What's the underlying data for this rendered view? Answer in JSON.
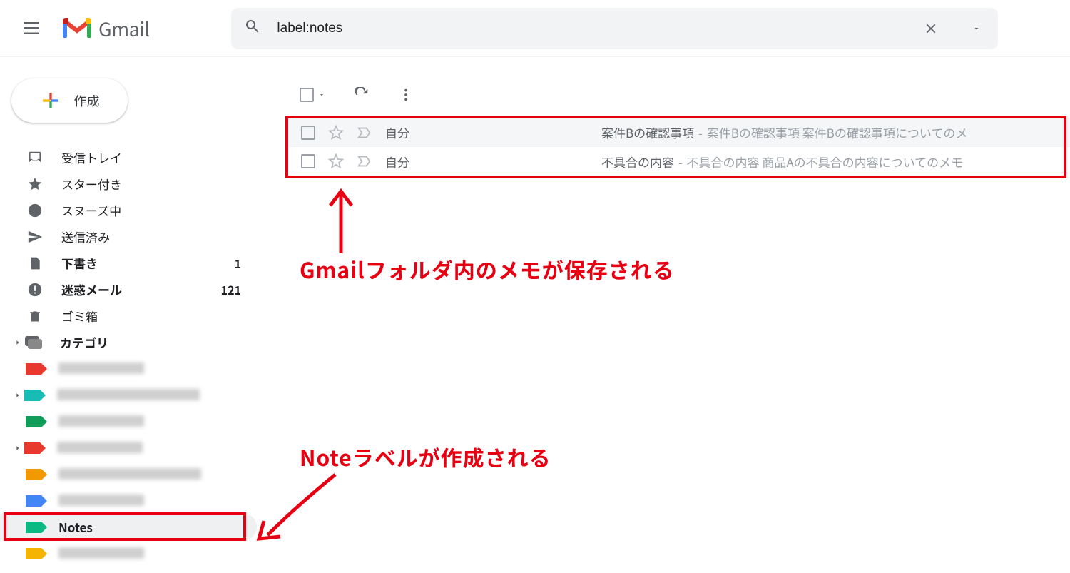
{
  "header": {
    "app_name": "Gmail",
    "search_value": "label:notes"
  },
  "sidebar": {
    "compose_label": "作成",
    "items": [
      {
        "label": "受信トレイ",
        "count": ""
      },
      {
        "label": "スター付き",
        "count": ""
      },
      {
        "label": "スヌーズ中",
        "count": ""
      },
      {
        "label": "送信済み",
        "count": ""
      },
      {
        "label": "下書き",
        "count": "1",
        "bold": true
      },
      {
        "label": "迷惑メール",
        "count": "121",
        "bold": true
      },
      {
        "label": "ゴミ箱",
        "count": ""
      },
      {
        "label": "カテゴリ",
        "count": "",
        "bold": true
      }
    ],
    "notes_label": "Notes"
  },
  "label_colors": {
    "red": "#e8392e",
    "cyan": "#17bcb5",
    "green": "#0f9d58",
    "orange": "#f29900",
    "blue": "#4285f4",
    "emerald": "#0bba82",
    "yellow": "#f4b400"
  },
  "mails": [
    {
      "sender": "自分",
      "subject": "案件Bの確認事項",
      "snippet": "案件Bの確認事項 案件Bの確認事項についてのメ"
    },
    {
      "sender": "自分",
      "subject": "不具合の内容",
      "snippet": "不具合の内容 商品Aの不具合の内容についてのメモ"
    }
  ],
  "annotations": {
    "top": "Gmailフォルダ内のメモが保存される",
    "bottom": "Noteラベルが作成される"
  }
}
